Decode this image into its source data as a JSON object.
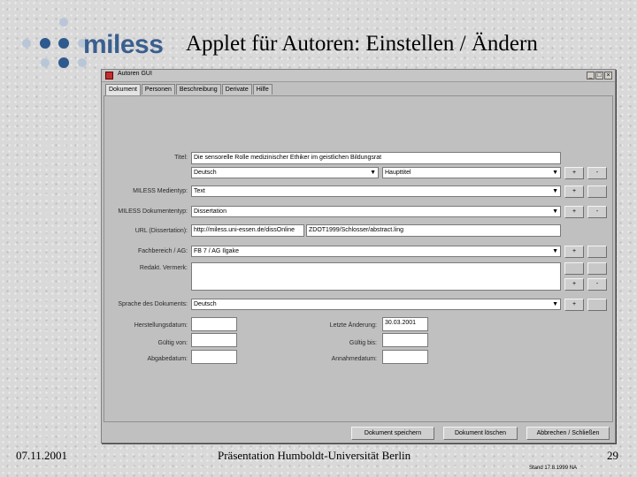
{
  "slide": {
    "logo_text": "miless",
    "title": "Applet für Autoren: Einstellen / Ändern",
    "date": "07.11.2001",
    "footer_center": "Präsentation Humboldt-Universität Berlin",
    "page_number": "29",
    "stand": "Stand 17.8.1999   NA"
  },
  "colors": {
    "logo_dot_blue": "#2e5a8e",
    "logo_dot_light": "#b8c6d8",
    "accent": "#3a5f8f"
  },
  "window": {
    "title": "Autoren GUI",
    "controls": [
      "_",
      "□",
      "×"
    ],
    "tabs": [
      "Dokument",
      "Personen",
      "Beschreibung",
      "Derivate",
      "Hilfe"
    ],
    "active_tab": "Dokument"
  },
  "form": {
    "titel": {
      "label": "Titel:",
      "value": "Die sensorelle Rolle medizinischer Ethiker im geistlichen Bildungsrat"
    },
    "titel_sprache": {
      "value": "Deutsch",
      "arrow": "▼"
    },
    "titel_art": {
      "value": "Haupttitel",
      "arrow": "▼"
    },
    "titel_add": "+",
    "titel_remove": "-",
    "medientyp": {
      "label": "MILESS Medientyp:",
      "value": "Text",
      "arrow": "▼"
    },
    "medientyp_add": "+",
    "dokumententyp": {
      "label": "MILESS Dokumententyp:",
      "value": "Dissertation",
      "arrow": "▼"
    },
    "dokumententyp_add": "+",
    "dokumententyp_remove": "-",
    "url": {
      "label": "URL (Dissertation):",
      "value": "http://miless.uni-essen.de/dissOnline",
      "value2": "ZDOT1999/Schlosser/abstract.ling"
    },
    "fachbereich": {
      "label": "Fachbereich / AG:",
      "value": "FB 7 / AG Ilgake",
      "arrow": "▼"
    },
    "fachbereich_add": "+",
    "vermerk": {
      "label": "Redakt. Vermerk:"
    },
    "vermerk_add": "+",
    "vermerk_remove": "-",
    "sprache": {
      "label": "Sprache des Dokuments:",
      "value": "Deutsch",
      "arrow": "▼"
    },
    "sprache_add": "+",
    "herstellungsdatum": {
      "label": "Herstellungsdatum:",
      "value": ""
    },
    "letzte_aenderung": {
      "label": "Letzte Änderung:",
      "value": "30.03.2001"
    },
    "gueltig_von": {
      "label": "Gültig von:",
      "value": ""
    },
    "gueltig_bis": {
      "label": "Gültig bis:",
      "value": ""
    },
    "abgabedatum": {
      "label": "Abgabedatum:",
      "value": ""
    },
    "annahmedatum": {
      "label": "Annahmedatum:",
      "value": ""
    }
  },
  "actions": {
    "save": "Dokument speichern",
    "delete": "Dokument löschen",
    "cancel": "Abbrechen / Schließen"
  }
}
